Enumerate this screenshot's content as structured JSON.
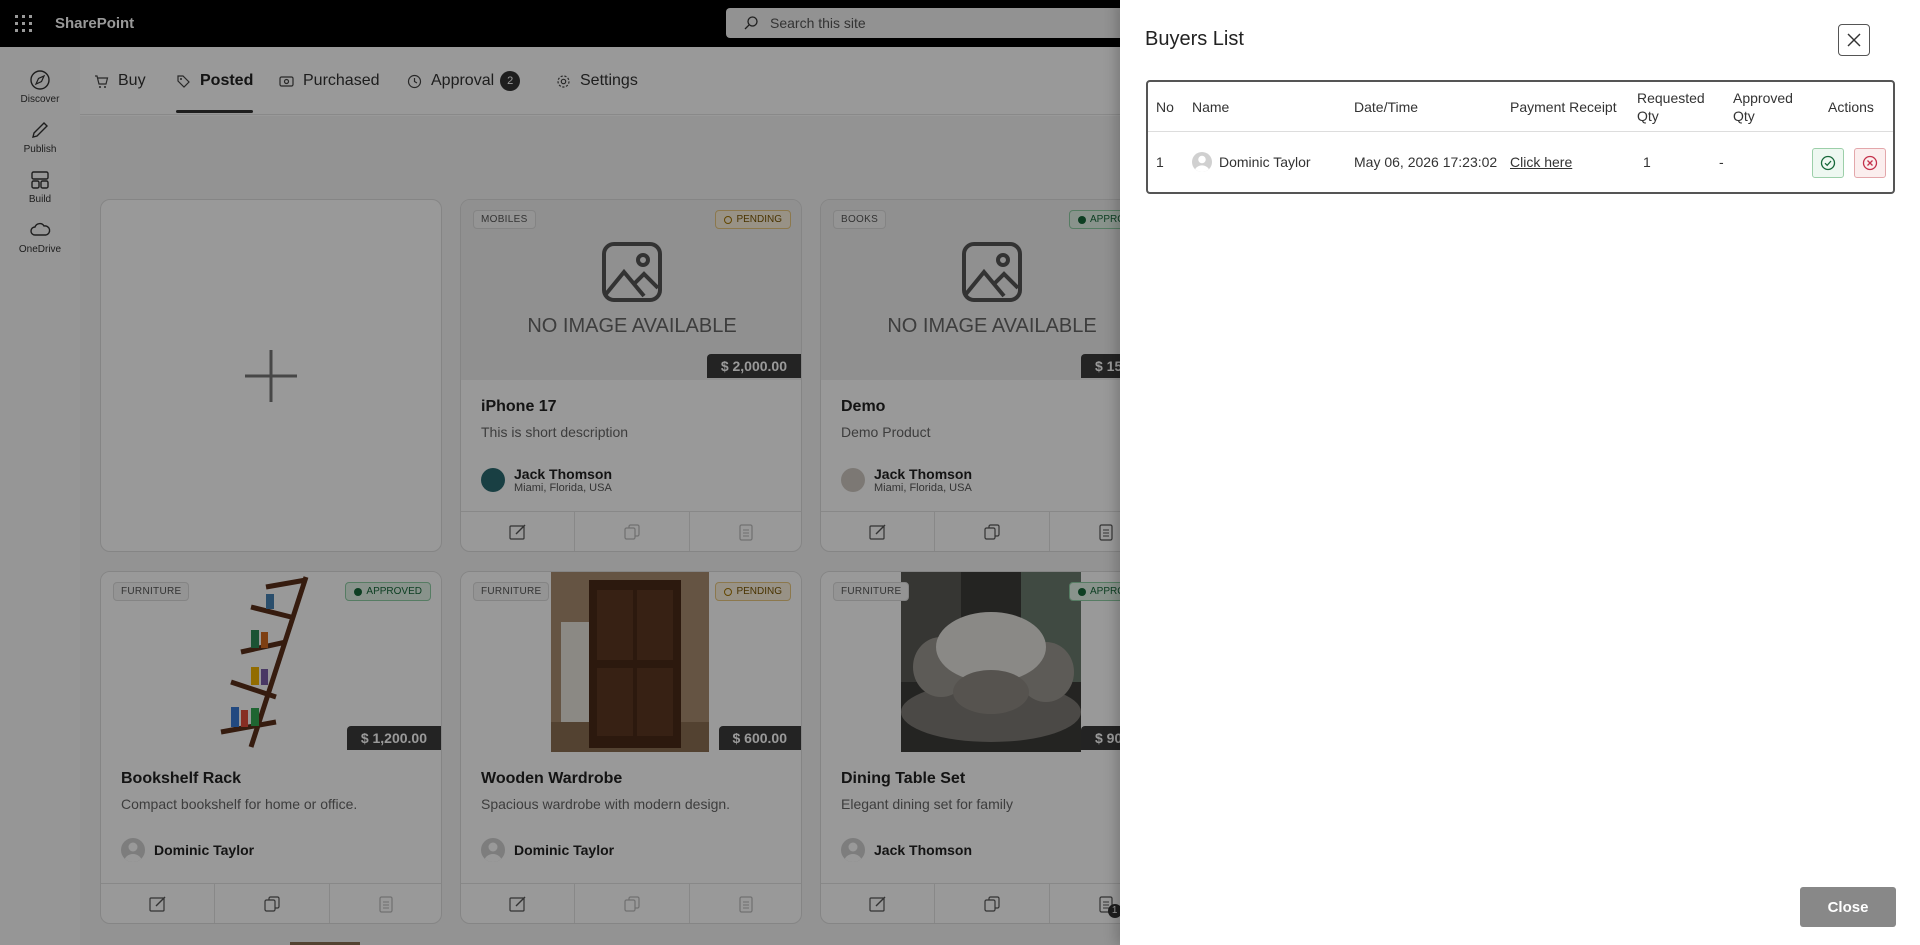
{
  "suite": {
    "app_name": "SharePoint",
    "search_placeholder": "Search this site"
  },
  "rail": [
    {
      "label": "Discover",
      "icon": "compass-icon"
    },
    {
      "label": "Publish",
      "icon": "pen-icon"
    },
    {
      "label": "Build",
      "icon": "grid-icon"
    },
    {
      "label": "OneDrive",
      "icon": "cloud-icon"
    }
  ],
  "tabs": [
    {
      "label": "Buy",
      "icon": "cart-icon"
    },
    {
      "label": "Posted",
      "icon": "tag-icon",
      "active": true
    },
    {
      "label": "Purchased",
      "icon": "receipt-icon"
    },
    {
      "label": "Approval",
      "icon": "clock-icon",
      "badge": "2"
    },
    {
      "label": "Settings",
      "icon": "gear-icon"
    }
  ],
  "cards": [
    {
      "category": "MOBILES",
      "status": "PENDING",
      "price": "$ 2,000.00",
      "no_image": "NO IMAGE AVAILABLE",
      "title": "iPhone 17",
      "description": "This is short description",
      "owner": "Jack Thomson",
      "location": "Miami, Florida, USA"
    },
    {
      "category": "BOOKS",
      "status": "APPROV",
      "price": "$ 15",
      "no_image": "NO IMAGE AVAILABLE",
      "title": "Demo",
      "description": "Demo Product",
      "owner": "Jack Thomson",
      "location": "Miami, Florida, USA"
    },
    {
      "category": "FURNITURE",
      "status": "APPROVED",
      "price": "$ 1,200.00",
      "title": "Bookshelf Rack",
      "description": "Compact bookshelf for home or office.",
      "owner": "Dominic Taylor"
    },
    {
      "category": "FURNITURE",
      "status": "PENDING",
      "price": "$ 600.00",
      "title": "Wooden Wardrobe",
      "description": "Spacious wardrobe with modern design.",
      "owner": "Dominic Taylor"
    },
    {
      "category": "FURNITURE",
      "status": "APPRO",
      "price": "$ 90",
      "title": "Dining Table Set",
      "description": "Elegant dining set for family",
      "owner": "Jack Thomson",
      "count_badge": "1"
    }
  ],
  "panel": {
    "title": "Buyers List",
    "columns": {
      "no": "No",
      "name": "Name",
      "datetime": "Date/Time",
      "receipt": "Payment Receipt",
      "requested": "Requested Qty",
      "approved": "Approved Qty",
      "actions": "Actions"
    },
    "rows": [
      {
        "no": "1",
        "name": "Dominic Taylor",
        "datetime": "May 06, 2026 17:23:02",
        "receipt": "Click here",
        "requested": "1",
        "approved": "-"
      }
    ],
    "close_label": "Close"
  },
  "colors": {
    "suitebar": "#000000",
    "approve": "#17683a",
    "reject": "#c4314b",
    "close_button": "#888888"
  }
}
